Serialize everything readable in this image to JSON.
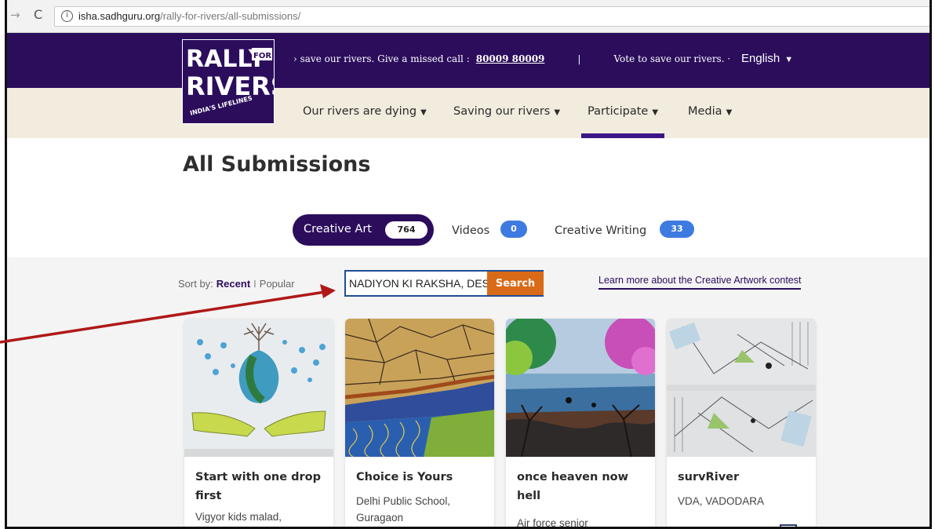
{
  "browser": {
    "back_icon": "→",
    "reload_icon": "C",
    "info_icon": "i",
    "url_domain": "isha.sadhguru.org",
    "url_path": "/rally-for-rivers/all-submissions/"
  },
  "topbar": {
    "ticker_text": "› save our rivers. Give a missed call :",
    "ticker_number": "80009 80009",
    "ticker_sep": "|",
    "ticker_text2": "Vote to save our rivers. ·",
    "language": "English",
    "language_caret": "▼"
  },
  "logo": {
    "line1": "RALLY",
    "for": "FOR",
    "line2": "RIVERS",
    "tagline": "INDIA'S LIFELINES"
  },
  "nav": {
    "items": [
      {
        "label": "Our rivers are dying"
      },
      {
        "label": "Saving our rivers"
      },
      {
        "label": "Participate"
      },
      {
        "label": "Media"
      }
    ],
    "caret": "▼",
    "active_index": 2
  },
  "page": {
    "title": "All Submissions"
  },
  "tabs": [
    {
      "label": "Creative Art",
      "count": "764"
    },
    {
      "label": "Videos",
      "count": "0"
    },
    {
      "label": "Creative Writing",
      "count": "33"
    }
  ],
  "sort": {
    "label": "Sort by:",
    "recent": "Recent",
    "divider": "I",
    "popular": "Popular"
  },
  "search": {
    "value": "NADIYON KI RAKSHA, DES",
    "button": "Search"
  },
  "learn_more": "Learn more about the Creative Artwork contest",
  "cards": [
    {
      "title": "Start with one drop first",
      "subtitle": "Vigyor kids malad,"
    },
    {
      "title": "Choice is Yours",
      "subtitle": "Delhi Public School, Guragaon"
    },
    {
      "title": "once heaven now hell",
      "subtitle": "Air force senior"
    },
    {
      "title": "survRiver",
      "subtitle": "VDA, VADODARA"
    }
  ],
  "colors": {
    "brand_purple": "#2b0d5c",
    "nav_beige": "#f2ecde",
    "search_orange": "#d96a17",
    "badge_blue": "#3d7be0",
    "annotation_red": "#b01818"
  }
}
